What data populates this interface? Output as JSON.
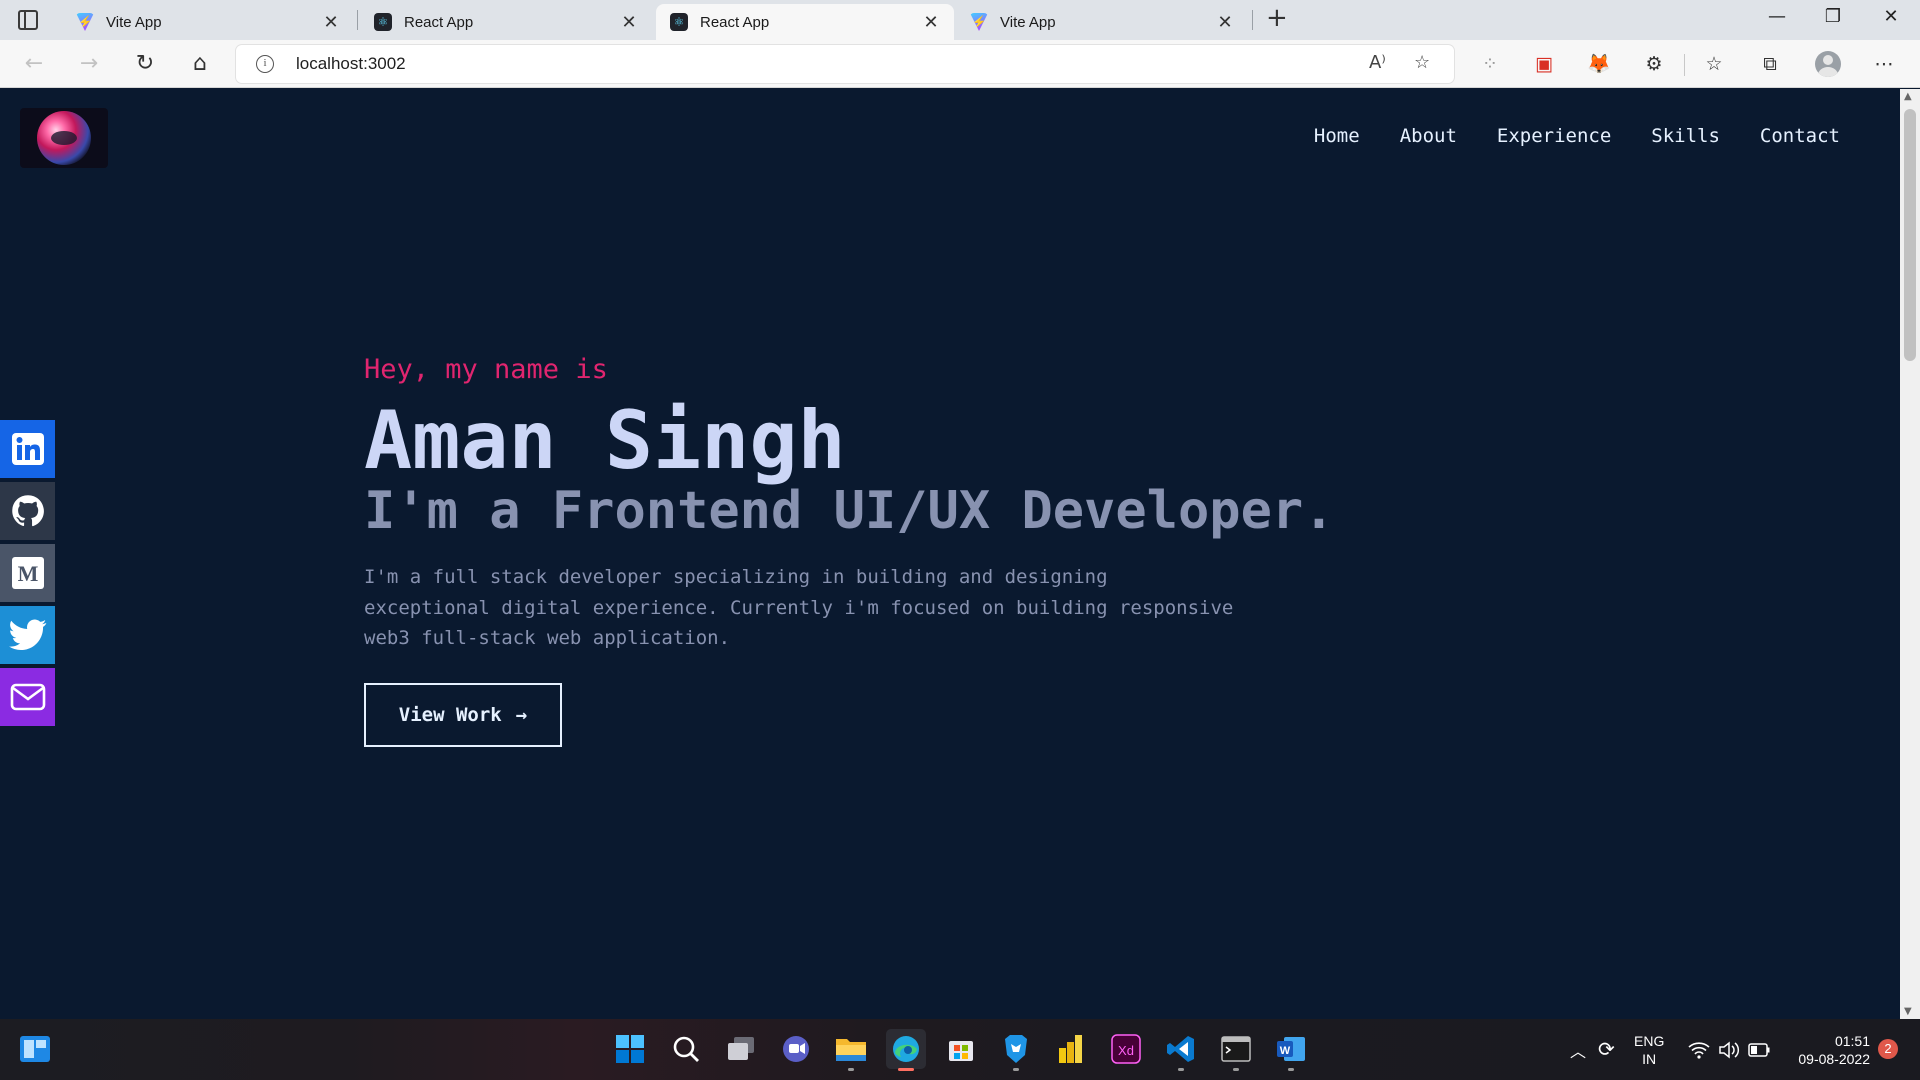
{
  "browser": {
    "tabs": [
      {
        "title": "Vite App",
        "favicon": "vite-icon",
        "active": false
      },
      {
        "title": "React App",
        "favicon": "react-icon",
        "active": false
      },
      {
        "title": "React App",
        "favicon": "react-icon",
        "active": true
      },
      {
        "title": "Vite App",
        "favicon": "vite-icon",
        "active": false
      }
    ],
    "url": "localhost:3002"
  },
  "site": {
    "nav": [
      "Home",
      "About",
      "Experience",
      "Skills",
      "Contact"
    ],
    "social": [
      "linkedin-icon",
      "github-icon",
      "medium-icon",
      "twitter-icon",
      "mail-icon"
    ],
    "hero": {
      "greeting": "Hey, my name is",
      "name": "Aman Singh",
      "role": "I'm a Frontend UI/UX Developer.",
      "description": "I'm a full stack developer specializing in building and designing exceptional digital experience. Currently i'm focused on building responsive web3 full-stack web application.",
      "cta": "View Work",
      "cta_arrow": "→"
    },
    "colors": {
      "background": "#0a192f",
      "accent": "#e0256f",
      "heading": "#ccd6f6",
      "muted": "#8892b0"
    }
  },
  "taskbar": {
    "apps": [
      "start-icon",
      "search-icon",
      "task-view-icon",
      "chat-icon",
      "file-explorer-icon",
      "edge-icon",
      "store-icon",
      "brave-icon",
      "power-bi-icon",
      "adobe-xd-icon",
      "vscode-icon",
      "terminal-icon",
      "word-icon"
    ],
    "lang_top": "ENG",
    "lang_bottom": "IN",
    "time": "01:51",
    "date": "09-08-2022",
    "notification_count": "2"
  }
}
